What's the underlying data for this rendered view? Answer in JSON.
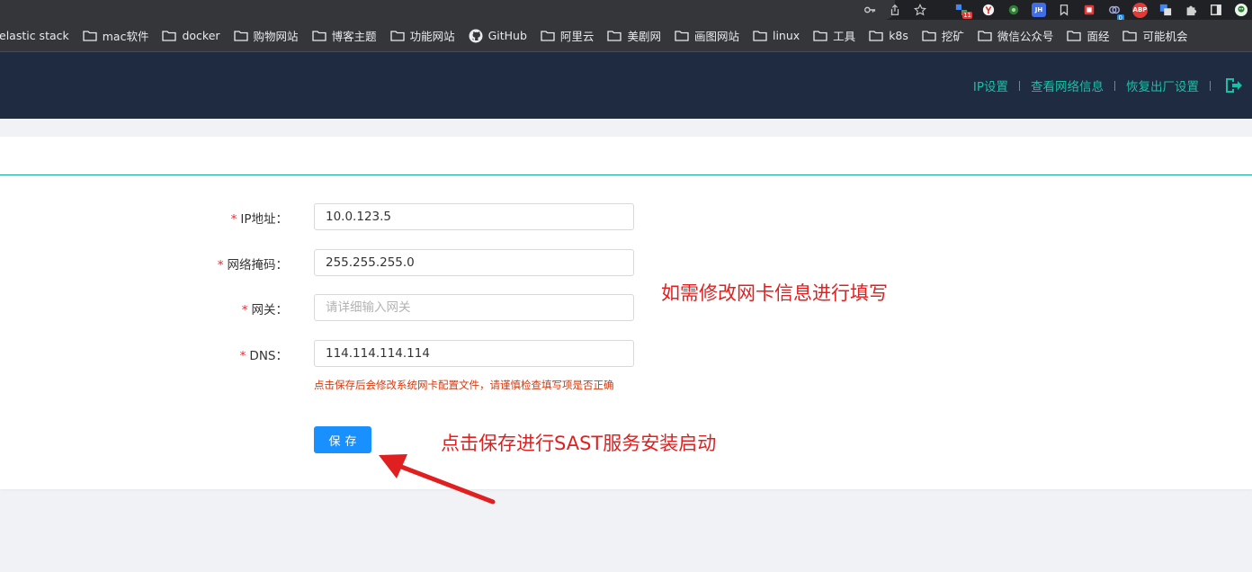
{
  "browser": {
    "bookmarks": [
      "elastic stack",
      "mac软件",
      "docker",
      "购物网站",
      "博客主题",
      "功能网站",
      "GitHub",
      "阿里云",
      "美剧网",
      "画图网站",
      "linux",
      "工具",
      "k8s",
      "挖矿",
      "微信公众号",
      "面经",
      "可能机会"
    ],
    "extension_badges": {
      "counter": "11",
      "counter2": "0",
      "jh": "JH",
      "abp": "ABP"
    }
  },
  "header": {
    "nav": [
      "IP设置",
      "查看网络信息",
      "恢复出厂设置"
    ],
    "logout_icon": "logout-icon",
    "accent_color": "#19c0a8",
    "bg_color": "#1e2b40"
  },
  "form": {
    "ip": {
      "label": "IP地址：",
      "value": "10.0.123.5"
    },
    "mask": {
      "label": "网络掩码：",
      "value": "255.255.255.0"
    },
    "gateway": {
      "label": "网关：",
      "value": "",
      "placeholder": "请详细输入网关"
    },
    "dns": {
      "label": "DNS：",
      "value": "114.114.114.114"
    },
    "required_mark": "*",
    "hint": "点击保存后会修改系统网卡配置文件，请谨慎检查填写项是否正确",
    "save_label": "保存"
  },
  "annotations": {
    "note1": "如需修改网卡信息进行填写",
    "note2": "点击保存进行SAST服务安装启动",
    "color": "#e02020"
  }
}
